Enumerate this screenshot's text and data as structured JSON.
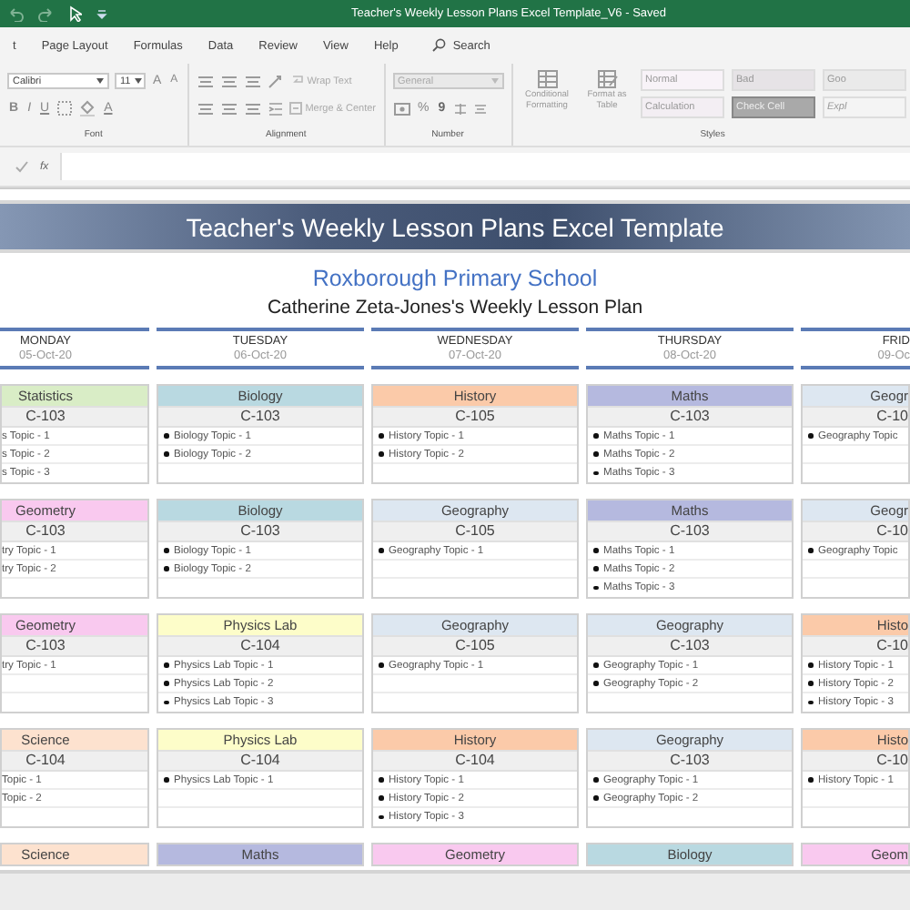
{
  "title_bar": {
    "title": "Teacher's Weekly Lesson Plans Excel Template_V6  -  Saved"
  },
  "menu_tabs": [
    "t",
    "Page Layout",
    "Formulas",
    "Data",
    "Review",
    "View",
    "Help"
  ],
  "search": {
    "placeholder": "Search"
  },
  "ribbon": {
    "font": {
      "name": "Calibri",
      "size": "11",
      "grow": "A",
      "shrink": "A",
      "bold": "B",
      "italic": "I",
      "underline": "U",
      "font_color": "A",
      "label": "Font"
    },
    "alignment": {
      "wrap_text": "Wrap Text",
      "merge": "Merge & Center",
      "label": "Alignment"
    },
    "number": {
      "format": "General",
      "percent": "%",
      "comma": "9",
      "label": "Number"
    },
    "styles": {
      "conditional": "Conditional Formatting",
      "format_table": "Format as Table",
      "label": "Styles",
      "cell_styles": [
        {
          "label": "Normal",
          "color": "#f8f3f8"
        },
        {
          "label": "Bad",
          "color": "#e6e3e6"
        },
        {
          "label": "Goo",
          "color": "#eaeaea"
        },
        {
          "label": "Calculation",
          "color": "#f3eef3"
        },
        {
          "label": "Check Cell",
          "color": "#a9a9a9"
        },
        {
          "label": "Expl",
          "color": "#f4f4f4"
        }
      ]
    }
  },
  "formula_bar": {
    "function_label": "fx"
  },
  "sheet": {
    "banner": "Teacher's Weekly Lesson Plans Excel Template",
    "school": "Roxborough Primary School",
    "plan_title": "Catherine Zeta-Jones's Weekly Lesson Plan",
    "days": [
      {
        "day": "MONDAY",
        "date": "05-Oct-20",
        "bullets": false,
        "lessons": [
          {
            "subject": "Statistics",
            "color": "#d9edc6",
            "room": "C-103",
            "topics": [
              "s Topic - 1",
              "s Topic - 2",
              "s Topic - 3"
            ]
          },
          {
            "subject": "Geometry",
            "color": "#f9c9ef",
            "room": "C-103",
            "topics": [
              "try Topic - 1",
              "try Topic - 2"
            ]
          },
          {
            "subject": "Geometry",
            "color": "#f9c9ef",
            "room": "C-103",
            "topics": [
              "try Topic - 1"
            ]
          },
          {
            "subject": "Science",
            "color": "#fde2cf",
            "room": "C-104",
            "topics": [
              "Topic - 1",
              "Topic - 2"
            ]
          },
          {
            "subject": "Science",
            "color": "#fde2cf"
          }
        ]
      },
      {
        "day": "TUESDAY",
        "date": "06-Oct-20",
        "bullets": true,
        "lessons": [
          {
            "subject": "Biology",
            "color": "#b9d9e1",
            "room": "C-103",
            "topics": [
              "Biology Topic - 1",
              "Biology Topic - 2"
            ]
          },
          {
            "subject": "Biology",
            "color": "#b9d9e1",
            "room": "C-103",
            "topics": [
              "Biology Topic - 1",
              "Biology Topic - 2"
            ]
          },
          {
            "subject": "Physics Lab",
            "color": "#fdfdc9",
            "room": "C-104",
            "topics": [
              "Physics Lab Topic - 1",
              "Physics Lab Topic - 2",
              "Physics Lab Topic - 3"
            ]
          },
          {
            "subject": "Physics Lab",
            "color": "#fdfdc9",
            "room": "C-104",
            "topics": [
              "Physics Lab Topic - 1"
            ]
          },
          {
            "subject": "Maths",
            "color": "#b5b9df"
          }
        ]
      },
      {
        "day": "WEDNESDAY",
        "date": "07-Oct-20",
        "bullets": true,
        "lessons": [
          {
            "subject": "History",
            "color": "#fbcaa9",
            "room": "C-105",
            "topics": [
              "History Topic - 1",
              "History Topic - 2"
            ]
          },
          {
            "subject": "Geography",
            "color": "#dde7f1",
            "room": "C-105",
            "topics": [
              "Geography Topic - 1"
            ]
          },
          {
            "subject": "Geography",
            "color": "#dde7f1",
            "room": "C-105",
            "topics": [
              "Geography Topic - 1"
            ]
          },
          {
            "subject": "History",
            "color": "#fbcaa9",
            "room": "C-104",
            "topics": [
              "History Topic - 1",
              "History Topic - 2",
              "History Topic - 3"
            ]
          },
          {
            "subject": "Geometry",
            "color": "#f9c9ef"
          }
        ]
      },
      {
        "day": "THURSDAY",
        "date": "08-Oct-20",
        "bullets": true,
        "lessons": [
          {
            "subject": "Maths",
            "color": "#b5b9df",
            "room": "C-103",
            "topics": [
              "Maths Topic - 1",
              "Maths Topic - 2",
              "Maths Topic - 3"
            ]
          },
          {
            "subject": "Maths",
            "color": "#b5b9df",
            "room": "C-103",
            "topics": [
              "Maths Topic - 1",
              "Maths Topic - 2",
              "Maths Topic - 3"
            ]
          },
          {
            "subject": "Geography",
            "color": "#dde7f1",
            "room": "C-103",
            "topics": [
              "Geography Topic - 1",
              "Geography Topic - 2"
            ]
          },
          {
            "subject": "Geography",
            "color": "#dde7f1",
            "room": "C-103",
            "topics": [
              "Geography Topic - 1",
              "Geography Topic - 2"
            ]
          },
          {
            "subject": "Biology",
            "color": "#b9d9e1"
          }
        ]
      },
      {
        "day": "FRID",
        "date": "09-Oc",
        "bullets": true,
        "lessons": [
          {
            "subject": "Geogr",
            "color": "#dde7f1",
            "room": "C-10",
            "topics": [
              "Geography Topic"
            ]
          },
          {
            "subject": "Geogr",
            "color": "#dde7f1",
            "room": "C-10",
            "topics": [
              "Geography Topic"
            ]
          },
          {
            "subject": "Histo",
            "color": "#fbcaa9",
            "room": "C-10",
            "topics": [
              "History Topic - 1",
              "History Topic - 2",
              "History Topic - 3"
            ]
          },
          {
            "subject": "Histo",
            "color": "#fbcaa9",
            "room": "C-10",
            "topics": [
              "History Topic - 1"
            ]
          },
          {
            "subject": "Geom",
            "color": "#f9c9ef"
          }
        ]
      }
    ]
  }
}
